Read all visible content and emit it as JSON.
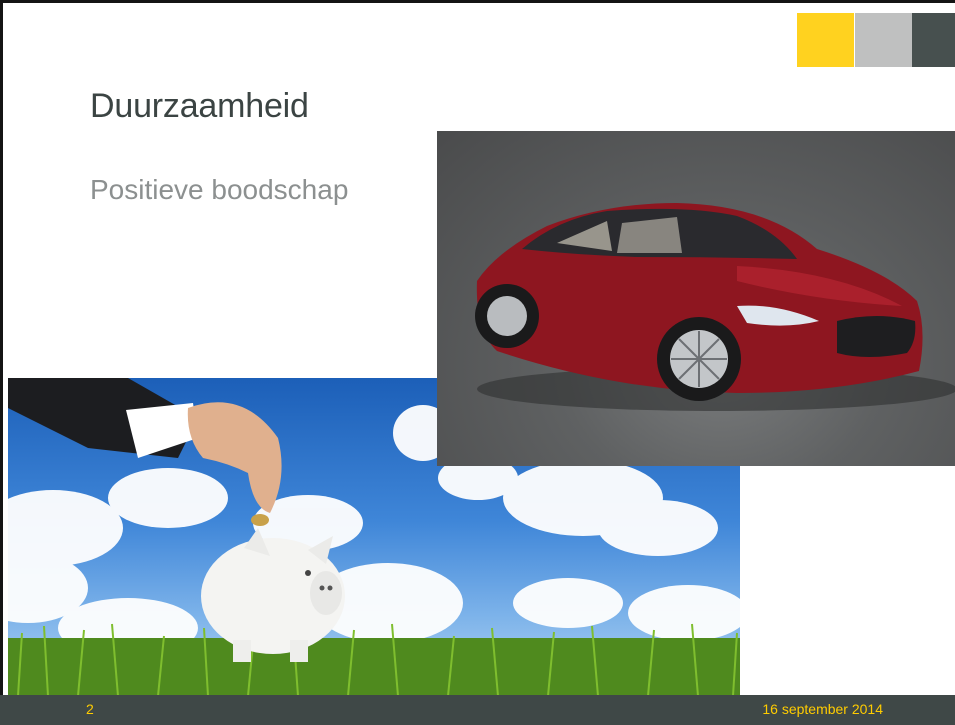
{
  "slide": {
    "title": "Duurzaamheid",
    "subtitle": "Positieve boodschap"
  },
  "images": {
    "car": "red-electric-sedan-photo",
    "piggy_bank": "hand-inserting-coin-into-piggy-bank-photo"
  },
  "footer": {
    "page_number": "2",
    "date": "16 september 2014"
  },
  "colors": {
    "accent_yellow": "#FFD21F",
    "accent_gray": "#BFC0C0",
    "accent_dark": "#47504F",
    "footer_bg": "#3F4847",
    "footer_text": "#FFCC00",
    "title_text": "#3B4443",
    "subtitle_text": "#8C9090"
  }
}
